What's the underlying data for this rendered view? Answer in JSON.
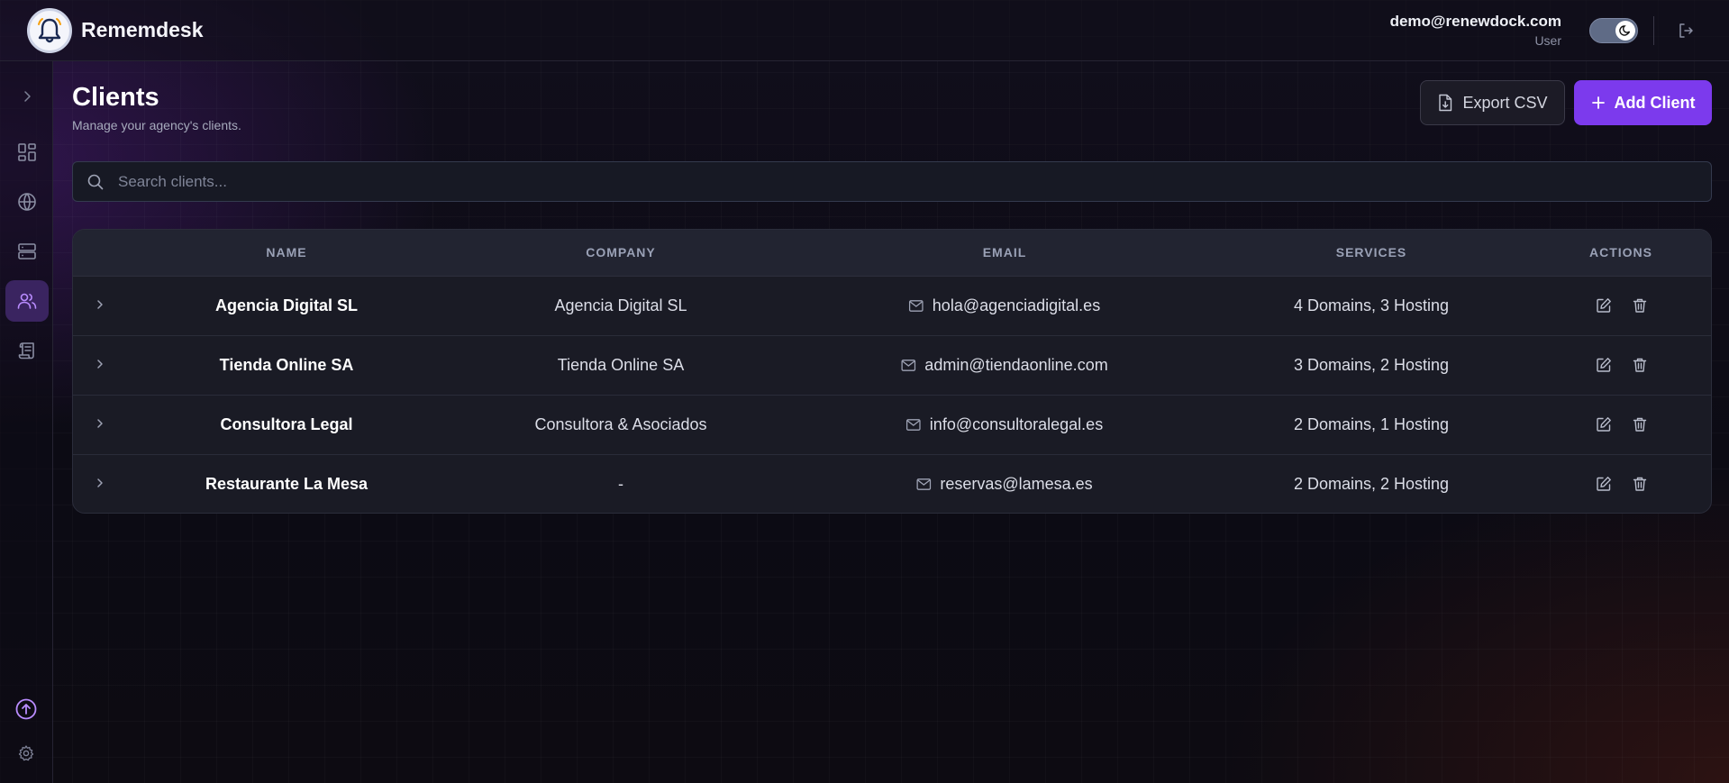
{
  "app": {
    "title": "Rememdesk"
  },
  "user": {
    "email": "demo@renewdock.com",
    "role": "User"
  },
  "page": {
    "title": "Clients",
    "subtitle": "Manage your agency's clients."
  },
  "actions": {
    "export_label": "Export CSV",
    "add_label": "Add Client"
  },
  "search": {
    "placeholder": "Search clients..."
  },
  "table": {
    "columns": [
      "NAME",
      "COMPANY",
      "EMAIL",
      "SERVICES",
      "ACTIONS"
    ],
    "rows": [
      {
        "name": "Agencia Digital SL",
        "company": "Agencia Digital SL",
        "email": "hola@agenciadigital.es",
        "services": "4 Domains, 3 Hosting"
      },
      {
        "name": "Tienda Online SA",
        "company": "Tienda Online SA",
        "email": "admin@tiendaonline.com",
        "services": "3 Domains, 2 Hosting"
      },
      {
        "name": "Consultora Legal",
        "company": "Consultora & Asociados",
        "email": "info@consultoralegal.es",
        "services": "2 Domains, 1 Hosting"
      },
      {
        "name": "Restaurante La Mesa",
        "company": "-",
        "email": "reservas@lamesa.es",
        "services": "2 Domains, 2 Hosting"
      }
    ]
  },
  "sidebar": {
    "items": [
      {
        "icon": "chevron-right-icon"
      },
      {
        "icon": "dashboard-icon"
      },
      {
        "icon": "globe-icon"
      },
      {
        "icon": "server-icon"
      },
      {
        "icon": "users-icon",
        "active": true
      },
      {
        "icon": "scroll-icon"
      },
      {
        "icon": "upgrade-icon"
      },
      {
        "icon": "gear-icon"
      }
    ]
  },
  "colors": {
    "accent": "#7c3aed",
    "active_bg": "#3a2460"
  }
}
